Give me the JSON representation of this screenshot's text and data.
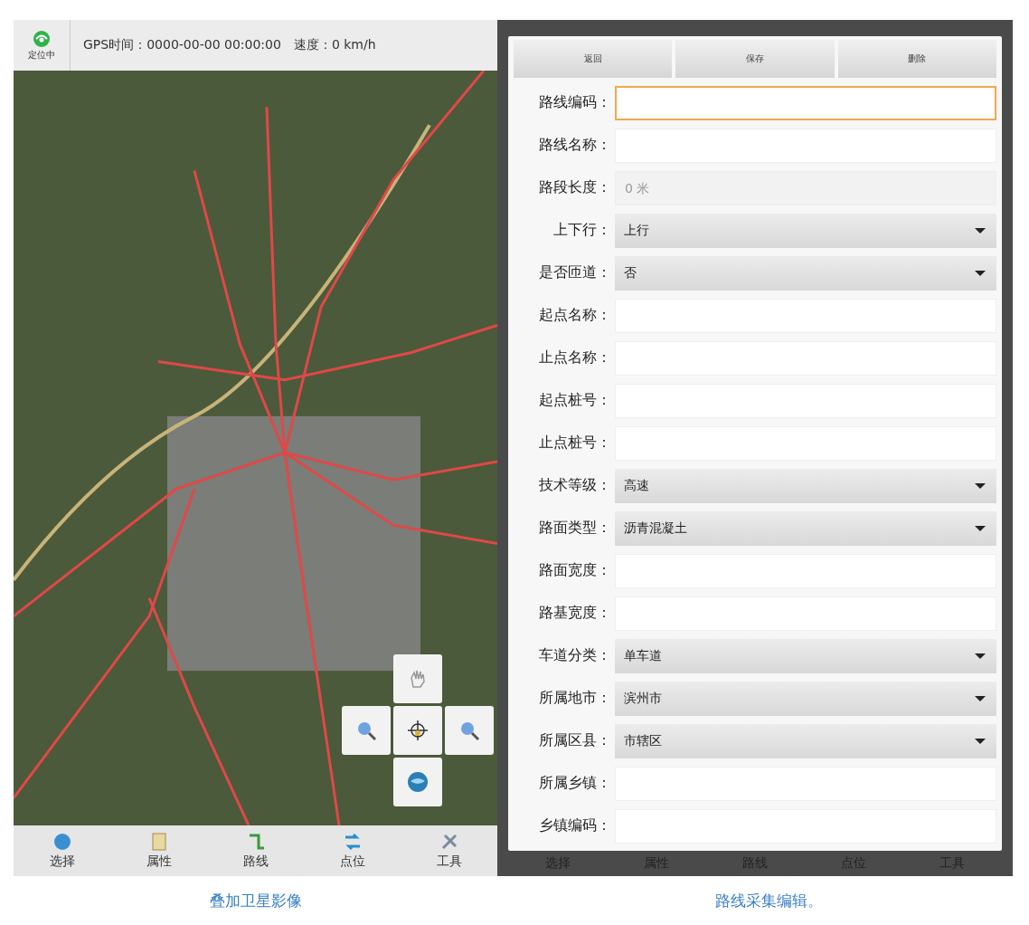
{
  "map_screen": {
    "status_bar": {
      "gps_label": "定位中",
      "gps_text": "GPS时间：0000-00-00 00:00:00",
      "speed_text": "速度：0 km/h"
    },
    "nav": [
      {
        "label": "选择"
      },
      {
        "label": "属性"
      },
      {
        "label": "路线"
      },
      {
        "label": "点位"
      },
      {
        "label": "工具"
      }
    ],
    "caption": "叠加卫星影像"
  },
  "form_screen": {
    "buttons": [
      "返回",
      "保存",
      "删除"
    ],
    "fields": [
      {
        "label": "路线编码：",
        "kind": "input",
        "focused": true
      },
      {
        "label": "路线名称：",
        "kind": "input",
        "focused": false
      },
      {
        "label": "路段长度：",
        "kind": "readonly",
        "placeholder": "0 米",
        "focused": false
      },
      {
        "label": "上下行：",
        "kind": "select",
        "value": "上行",
        "focused": false
      },
      {
        "label": "是否匝道：",
        "kind": "select",
        "value": "否",
        "focused": false
      },
      {
        "label": "起点名称：",
        "kind": "input",
        "focused": false
      },
      {
        "label": "止点名称：",
        "kind": "input",
        "focused": false
      },
      {
        "label": "起点桩号：",
        "kind": "input",
        "focused": false
      },
      {
        "label": "止点桩号：",
        "kind": "input",
        "focused": false
      },
      {
        "label": "技术等级：",
        "kind": "select",
        "value": "高速",
        "focused": false
      },
      {
        "label": "路面类型：",
        "kind": "select",
        "value": "沥青混凝土",
        "focused": false
      },
      {
        "label": "路面宽度：",
        "kind": "input",
        "focused": false
      },
      {
        "label": "路基宽度：",
        "kind": "input",
        "focused": false
      },
      {
        "label": "车道分类：",
        "kind": "select",
        "value": "单车道",
        "focused": false
      },
      {
        "label": "所属地市：",
        "kind": "select",
        "value": "滨州市",
        "focused": false
      },
      {
        "label": "所属区县：",
        "kind": "select",
        "value": "市辖区",
        "focused": false
      },
      {
        "label": "所属乡镇：",
        "kind": "input",
        "focused": false
      },
      {
        "label": "乡镇编码：",
        "kind": "input",
        "focused": false
      }
    ],
    "nav": [
      {
        "label": "选择"
      },
      {
        "label": "属性"
      },
      {
        "label": "路线"
      },
      {
        "label": "点位"
      },
      {
        "label": "工具"
      }
    ],
    "caption": "路线采集编辑。"
  }
}
